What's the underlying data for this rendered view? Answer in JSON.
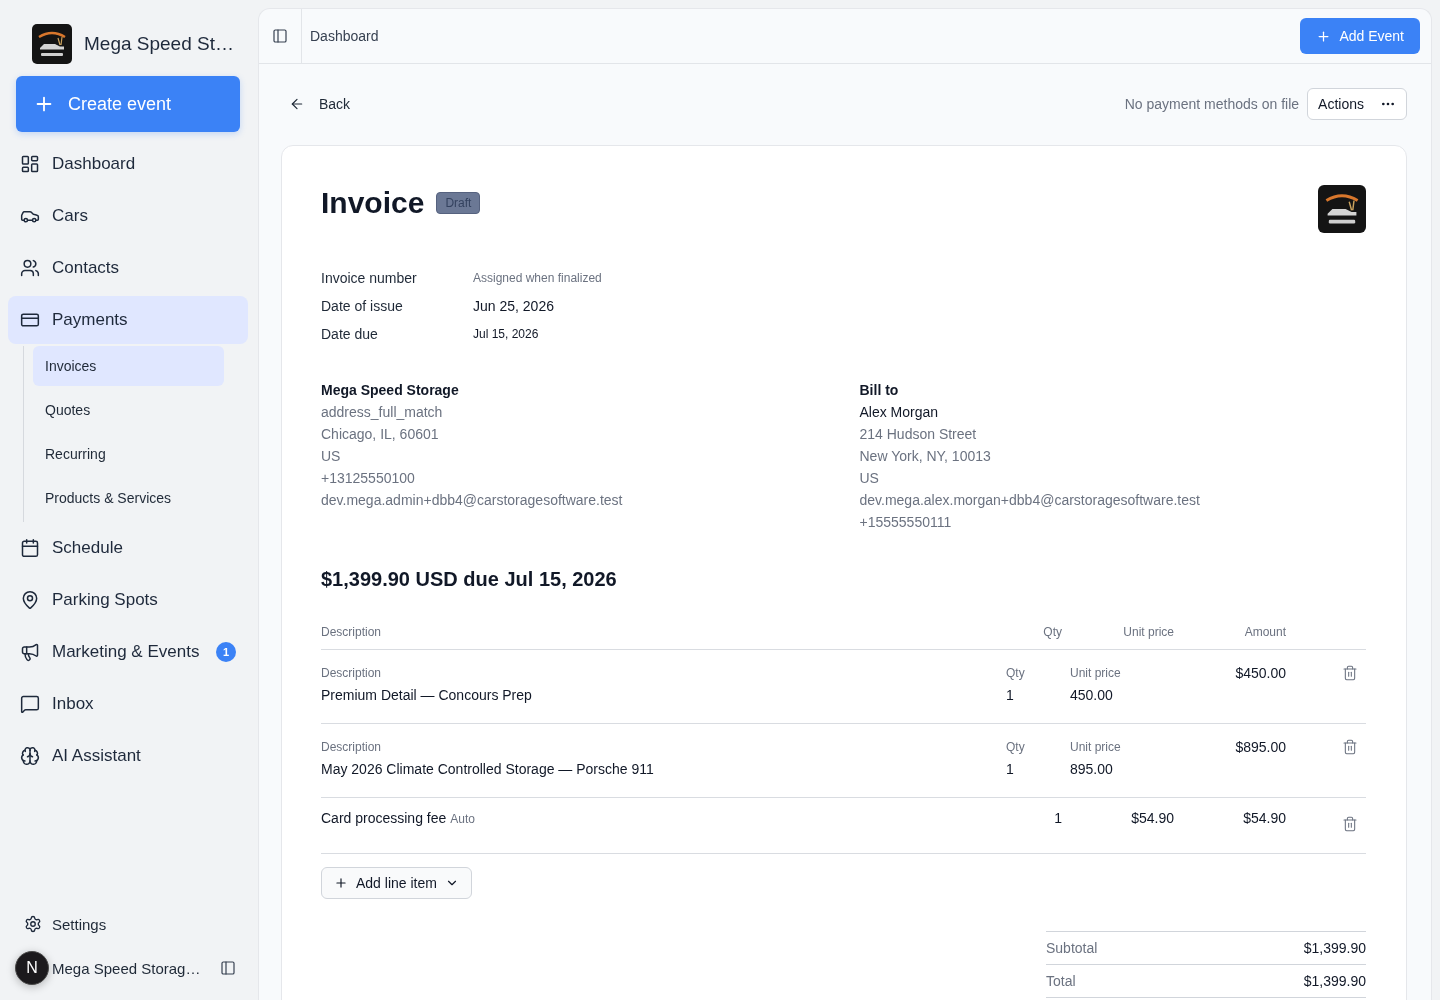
{
  "sidebar": {
    "brand": "Mega Speed St…",
    "create_button": "Create event",
    "nav": [
      {
        "label": "Dashboard",
        "selected": false
      },
      {
        "label": "Cars",
        "selected": false
      },
      {
        "label": "Contacts",
        "selected": false
      },
      {
        "label": "Payments",
        "selected": true,
        "children": [
          {
            "label": "Invoices",
            "selected": true
          },
          {
            "label": "Quotes",
            "selected": false
          },
          {
            "label": "Recurring",
            "selected": false
          },
          {
            "label": "Products & Services",
            "selected": false
          }
        ]
      },
      {
        "label": "Schedule",
        "selected": false
      },
      {
        "label": "Parking Spots",
        "selected": false
      },
      {
        "label": "Marketing & Events",
        "selected": false,
        "badge": "1"
      },
      {
        "label": "Inbox",
        "selected": false
      },
      {
        "label": "AI Assistant",
        "selected": false
      }
    ],
    "settings": "Settings",
    "account": "Mega Speed Storag…",
    "dev_badge": "N"
  },
  "header": {
    "breadcrumb": "Dashboard",
    "add_button": "Add Event"
  },
  "toolbar": {
    "back": "Back",
    "payment_note": "No payment methods on file",
    "actions": "Actions"
  },
  "invoice": {
    "title": "Invoice",
    "status": "Draft",
    "meta": [
      {
        "label": "Invoice number",
        "value": "Assigned when finalized",
        "kind": "note"
      },
      {
        "label": "Date of issue",
        "value": "Jun 25, 2026",
        "kind": "text"
      },
      {
        "label": "Date due",
        "value": "Jul 15, 2026",
        "kind": "compact"
      }
    ],
    "from": {
      "name": "Mega Speed Storage",
      "lines": [
        "address_full_match",
        "Chicago, IL, 60601",
        "US",
        "+13125550100",
        "dev.mega.admin+dbb4@carstoragesoftware.test"
      ]
    },
    "bill_to": {
      "heading": "Bill to",
      "name": "Alex Morgan",
      "lines": [
        "214 Hudson Street",
        "New York, NY, 10013",
        "US",
        "dev.mega.alex.morgan+dbb4@carstoragesoftware.test",
        "+15555550111"
      ]
    },
    "amount_due": "$1,399.90 USD due Jul 15, 2026",
    "columns": [
      "Description",
      "Qty",
      "Unit price",
      "Amount"
    ],
    "line_items": [
      {
        "kind": "editable",
        "description_label": "Description",
        "description": "Premium Detail — Concours Prep",
        "qty_label": "Qty",
        "qty": "1",
        "unit_price_label": "Unit price",
        "unit_price": "450.00",
        "amount": "$450.00"
      },
      {
        "kind": "editable",
        "description_label": "Description",
        "description": "May 2026 Climate Controlled Storage — Porsche 911",
        "qty_label": "Qty",
        "qty": "1",
        "unit_price_label": "Unit price",
        "unit_price": "895.00",
        "amount": "$895.00"
      },
      {
        "kind": "fee",
        "description": "Card processing fee",
        "tag": "Auto",
        "qty": "1",
        "unit_price": "$54.90",
        "amount": "$54.90"
      }
    ],
    "add_line_item": "Add line item",
    "totals": [
      {
        "label": "Subtotal",
        "value": "$1,399.90"
      },
      {
        "label": "Total",
        "value": "$1,399.90"
      }
    ]
  }
}
